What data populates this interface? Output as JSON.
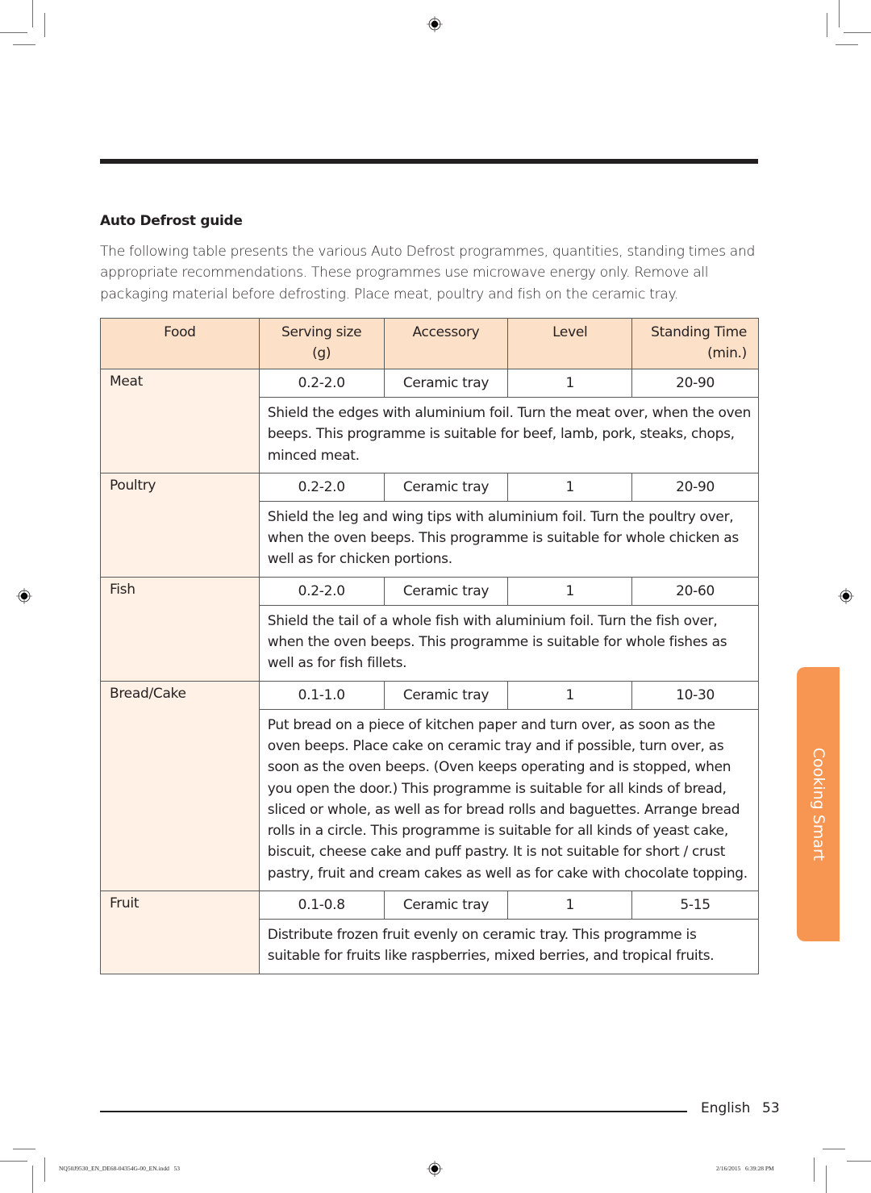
{
  "section": {
    "title": "Auto Defrost guide",
    "intro": "The following table presents the various Auto Defrost programmes, quantities, standing times and appropriate recommendations. These programmes use microwave energy only. Remove all packaging material before defrosting. Place meat, poultry and fish on the ceramic tray."
  },
  "table": {
    "headers": {
      "food": "Food",
      "serving_size": "Serving size",
      "serving_unit": "(g)",
      "accessory": "Accessory",
      "level": "Level",
      "standing_time": "Standing Time",
      "standing_unit": "(min.)"
    },
    "rows": [
      {
        "food": "Meat",
        "serving": "0.2-2.0",
        "accessory": "Ceramic tray",
        "level": "1",
        "standing": "20-90",
        "note": "Shield the edges with aluminium foil. Turn the meat over, when the oven beeps. This programme is suitable for beef, lamb, pork, steaks, chops, minced meat."
      },
      {
        "food": "Poultry",
        "serving": "0.2-2.0",
        "accessory": "Ceramic tray",
        "level": "1",
        "standing": "20-90",
        "note": "Shield the leg and wing tips with aluminium foil. Turn the poultry over, when the oven beeps. This programme is suitable for whole chicken as well as for chicken portions."
      },
      {
        "food": "Fish",
        "serving": "0.2-2.0",
        "accessory": "Ceramic tray",
        "level": "1",
        "standing": "20-60",
        "note": "Shield the tail of a whole fish with aluminium foil. Turn the fish over, when the oven beeps. This programme is suitable for whole fishes as well as for fish fillets."
      },
      {
        "food": "Bread/Cake",
        "serving": "0.1-1.0",
        "accessory": "Ceramic tray",
        "level": "1",
        "standing": "10-30",
        "note": "Put bread on a piece of kitchen paper and turn over, as soon as the oven beeps. Place cake on ceramic tray and if possible, turn over, as soon as the oven beeps. (Oven keeps operating and is stopped, when you open the door.) This programme is suitable for all kinds of bread, sliced or whole, as well as for bread rolls and baguettes. Arrange bread rolls in a circle. This programme is suitable for all kinds of yeast cake, biscuit, cheese cake and puff pastry. It is not suitable for short / crust pastry, fruit and cream cakes as well as for cake with chocolate topping."
      },
      {
        "food": "Fruit",
        "serving": "0.1-0.8",
        "accessory": "Ceramic tray",
        "level": "1",
        "standing": "5-15",
        "note": "Distribute frozen fruit evenly on ceramic tray. This programme is suitable for fruits like raspberries, mixed berries, and tropical fruits."
      }
    ]
  },
  "side_tab": {
    "label": "Cooking Smart",
    "color": "#f79552"
  },
  "footer": {
    "language": "English",
    "page": "53"
  },
  "print_slug": {
    "file": "NQ50J9530_EN_DE68-04354G-00_EN.indd   53",
    "datetime": "2/16/2015   6:39:28 PM"
  },
  "colors": {
    "header_bg": "#fde0c8",
    "food_col_bg": "#fff1e5",
    "text": "#231f20"
  }
}
